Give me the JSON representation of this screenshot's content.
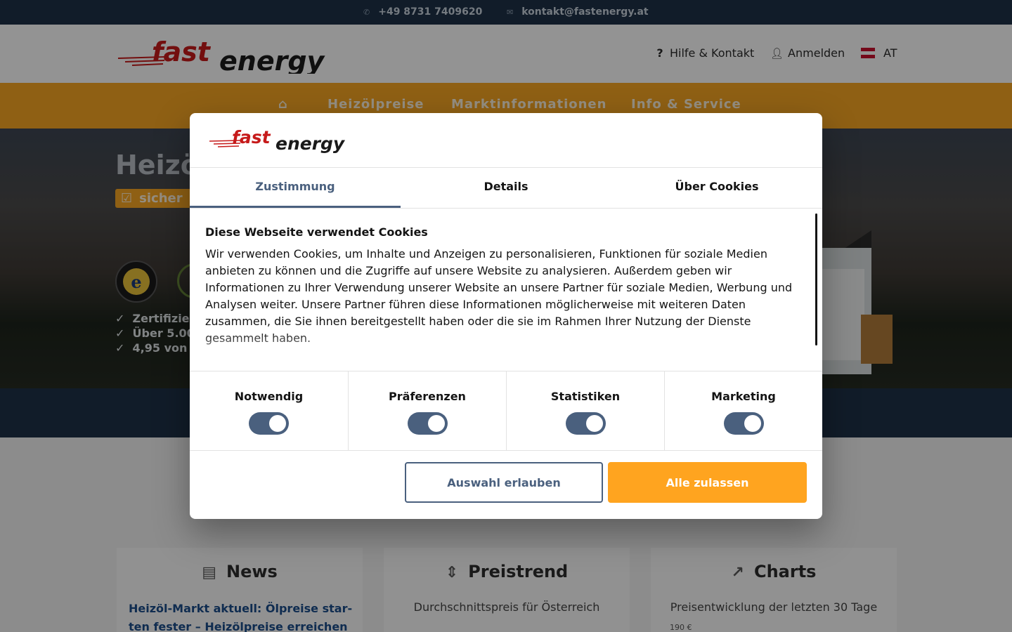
{
  "topbar": {
    "phone": "+49 8731 7409620",
    "email": "kontakt@fastenergy.at",
    "phone_icon": "phone-icon",
    "email_icon": "mail-icon"
  },
  "header": {
    "logo_text_left": "fast",
    "logo_text_right": "energy",
    "help_label": "Hilfe & Kontakt",
    "login_label": "Anmelden",
    "country_label": "AT"
  },
  "nav": {
    "home_icon": "home-icon",
    "items": [
      "Heizölpreise",
      "Marktinformationen",
      "Info & Service"
    ]
  },
  "hero": {
    "title": "Heizö",
    "badge": "sicher",
    "checks": [
      "Zertifizier",
      "Über 5.00",
      "4,95 von"
    ]
  },
  "cards": [
    {
      "title": "News",
      "icon": "newspaper-icon",
      "link": "Heizöl-Markt aktuell: Ölpreise star-ten fester – Heizölpreise erreichen"
    },
    {
      "title": "Preistrend",
      "icon": "signpost-icon",
      "subtitle": "Durchschnittspreis für Österreich"
    },
    {
      "title": "Charts",
      "icon": "line-chart-icon",
      "subtitle": "Preisentwicklung der letzten 30 Tage",
      "axis_label": "190 €"
    }
  ],
  "cookie_dialog": {
    "tabs": [
      "Zustimmung",
      "Details",
      "Über Cookies"
    ],
    "active_tab": "Zustimmung",
    "heading": "Diese Webseite verwendet Cookies",
    "text": "Wir verwenden Cookies, um Inhalte und Anzeigen zu personalisieren, Funktionen für soziale Medien anbieten zu können und die Zugriffe auf unsere Website zu analysieren. Außerdem geben wir Informationen zu Ihrer Verwendung unserer Website an unsere Partner für soziale Medien, Werbung und Analysen weiter. Unsere Partner führen diese Informationen möglicherweise mit weiteren Daten zusammen, die Sie ihnen bereitgestellt haben oder die sie im Rahmen Ihrer Nutzung der Dienste gesammelt haben.",
    "toggles": [
      {
        "label": "Notwendig",
        "on": true
      },
      {
        "label": "Präferenzen",
        "on": true
      },
      {
        "label": "Statistiken",
        "on": true
      },
      {
        "label": "Marketing",
        "on": true
      }
    ],
    "allow_selection_label": "Auswahl erlauben",
    "allow_all_label": "Alle zulassen"
  },
  "colors": {
    "navy": "#1e3148",
    "orange": "#f6a623",
    "accent": "#4a607e",
    "button_orange": "#ffa41f"
  }
}
